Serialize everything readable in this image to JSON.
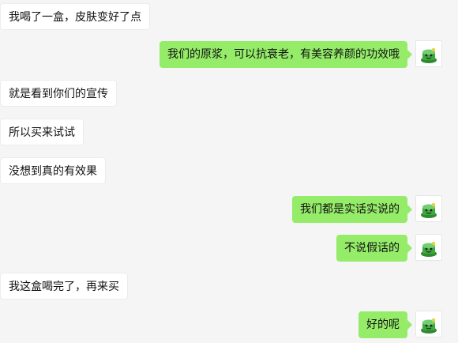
{
  "colors": {
    "background": "#f5f5f5",
    "incoming_bubble": "#ffffff",
    "outgoing_bubble": "#95ec69"
  },
  "messages": [
    {
      "direction": "in",
      "text": "我喝了一盒，皮肤变好了点"
    },
    {
      "direction": "out",
      "text": "我们的原浆，可以抗衰老，有美容养颜的功效哦",
      "avatar": "green-hat-cartoon-icon"
    },
    {
      "direction": "in",
      "text": "就是看到你们的宣传"
    },
    {
      "direction": "in",
      "text": "所以买来试试"
    },
    {
      "direction": "in",
      "text": "没想到真的有效果"
    },
    {
      "direction": "out",
      "text": "我们都是实话实说的",
      "avatar": "green-hat-cartoon-icon"
    },
    {
      "direction": "out",
      "text": "不说假话的",
      "avatar": "green-hat-cartoon-icon"
    },
    {
      "direction": "in",
      "text": "我这盒喝完了，再来买"
    },
    {
      "direction": "out",
      "text": "好的呢",
      "avatar": "green-hat-cartoon-icon"
    }
  ]
}
